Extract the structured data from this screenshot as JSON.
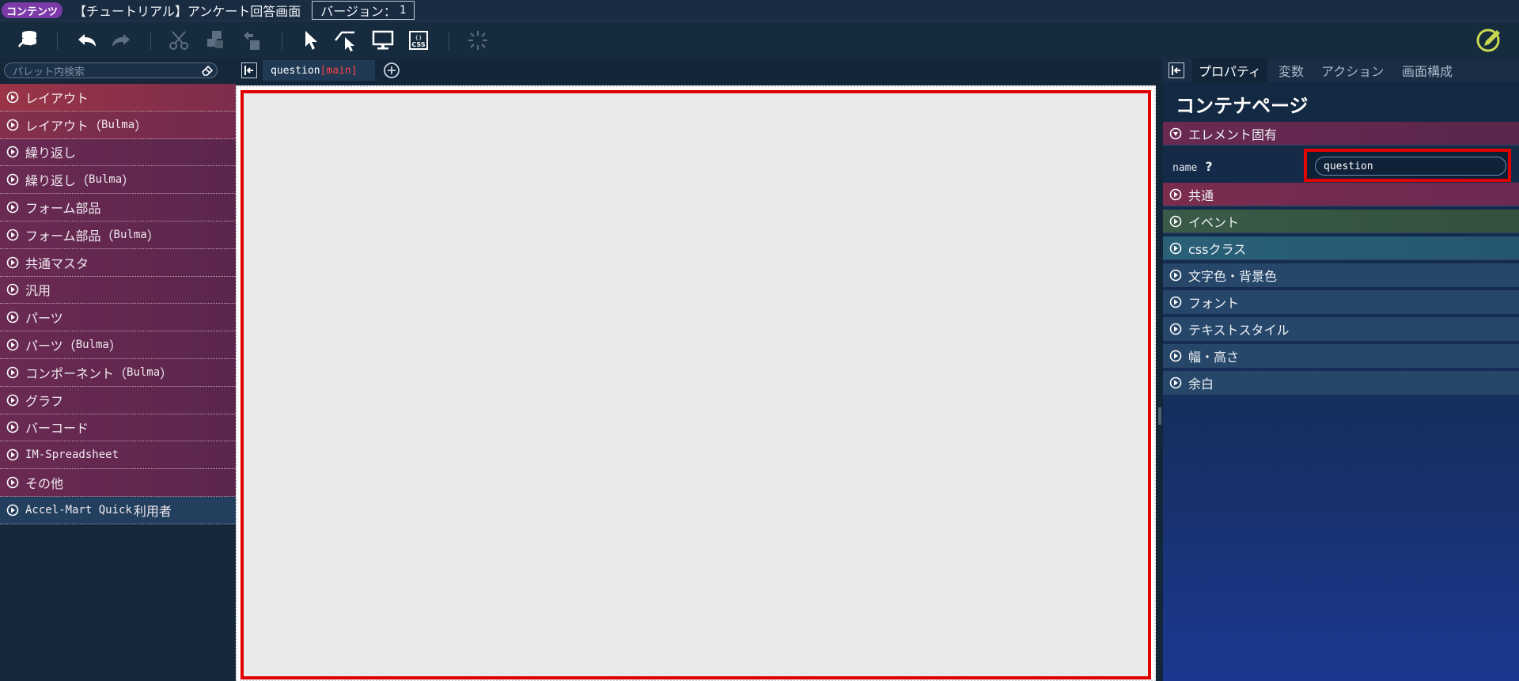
{
  "titlebar": {
    "badge": "コンテンツ",
    "title": "【チュートリアル】アンケート回答画面",
    "version_label": "バージョン：",
    "version_number": "1"
  },
  "toolbar": {
    "icons": [
      "database-icon",
      "undo-icon",
      "redo-icon",
      "cut-icon",
      "copy-icon",
      "paste-icon",
      "select-pointer-icon",
      "area-select-icon",
      "preview-icon",
      "css-icon",
      "loading-icon",
      "edit-icon"
    ]
  },
  "palette": {
    "search_placeholder": "パレット内検索",
    "items": [
      {
        "label": "レイアウト",
        "latin": ""
      },
      {
        "label": "レイアウト（",
        "latin": "Bulma",
        "tail": "）"
      },
      {
        "label": "繰り返し",
        "latin": ""
      },
      {
        "label": "繰り返し（",
        "latin": "Bulma",
        "tail": "）"
      },
      {
        "label": "フォーム部品",
        "latin": ""
      },
      {
        "label": "フォーム部品（",
        "latin": "Bulma",
        "tail": "）"
      },
      {
        "label": "共通マスタ",
        "latin": ""
      },
      {
        "label": "汎用",
        "latin": ""
      },
      {
        "label": "パーツ",
        "latin": ""
      },
      {
        "label": "パーツ（",
        "latin": "Bulma",
        "tail": "）"
      },
      {
        "label": "コンポーネント（",
        "latin": "Bulma",
        "tail": "）"
      },
      {
        "label": "グラフ",
        "latin": ""
      },
      {
        "label": "バーコード",
        "latin": ""
      },
      {
        "label": "",
        "latin": "IM-Spreadsheet"
      },
      {
        "label": "その他",
        "latin": ""
      },
      {
        "label": "",
        "latin": "Accel-Mart Quick ",
        "tail": "利用者"
      }
    ]
  },
  "center": {
    "tab_name": "question",
    "tab_tag": "[main]"
  },
  "props": {
    "tabs": [
      "プロパティ",
      "変数",
      "アクション",
      "画面構成"
    ],
    "heading": "コンテナページ",
    "sections": {
      "element": "エレメント固有",
      "common": "共通",
      "event": "イベント",
      "css": "cssクラス",
      "color": "文字色・背景色",
      "font": "フォント",
      "text_style": "テキストスタイル",
      "size": "幅・高さ",
      "margin": "余白"
    },
    "name_label": "name",
    "help": "?",
    "name_value": "question"
  },
  "colors": {
    "highlight": "#e00000",
    "badge": "#7b3aa8",
    "palette_item": "#6a2a52",
    "accent_edit": "#c8d850"
  }
}
